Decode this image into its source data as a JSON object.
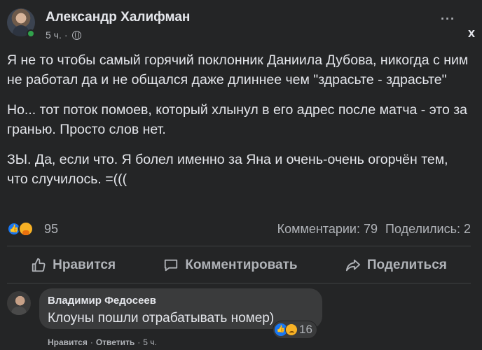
{
  "post": {
    "author": "Александр Халифман",
    "time": "5 ч.",
    "dot": "·",
    "more": "···",
    "close": "x",
    "paragraphs": [
      "Я не то чтобы самый горячий поклонник Даниила Дубова, никогда с ним не работал да и не общался даже длиннее чем \"здрасьте - здрасьте\"",
      "Но... тот поток помоев, который хлынул в его адрес после матча - это за гранью. Просто слов нет.",
      "ЗЫ. Да, если что. Я болел именно за Яна и очень-очень огорчён тем, что случилось. =((("
    ],
    "reaction_count": "95",
    "comments_count": "Комментарии: 79",
    "shares_count": "Поделились: 2"
  },
  "actions": {
    "like": "Нравится",
    "comment": "Комментировать",
    "share": "Поделиться"
  },
  "comment": {
    "author": "Владимир Федосеев",
    "text": "Клоуны пошли отрабатывать номер)",
    "reaction_count": "16",
    "like": "Нравится",
    "reply": "Ответить",
    "sep": "·",
    "time": "5 ч."
  },
  "colors": {
    "background": "#242526",
    "bubble": "#3a3b3c",
    "like_blue": "#1877f2",
    "secondary_text": "#b0b3b8"
  },
  "icons": {
    "like": "thumbs-up-icon",
    "comment": "speech-bubble-icon",
    "share": "share-arrow-icon",
    "audience": "globe-icon"
  }
}
